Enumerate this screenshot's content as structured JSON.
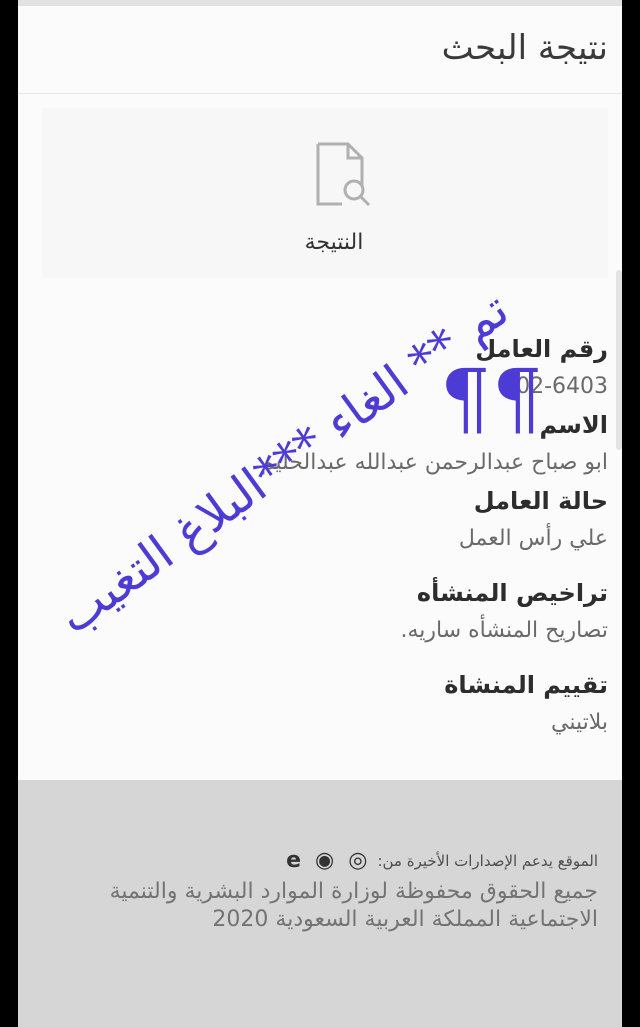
{
  "header": {
    "title": "نتيجة البحث"
  },
  "result": {
    "label": "النتيجة"
  },
  "details": [
    {
      "label": "رقم العامل",
      "value": "102-6403"
    },
    {
      "label": "الاسم",
      "value": "ابو صباح عبدالرحمن عبدالله عبدالحليم"
    },
    {
      "label": "حالة العامل",
      "value": "علي رأس العمل"
    },
    {
      "label": "تراخيص المنشأه",
      "value": "تصاريح المنشأه ساريه."
    },
    {
      "label": "تقييم المنشاة",
      "value": "بلاتيني"
    }
  ],
  "footer": {
    "support_text": "الموقع يدعم الإصدارات الأخيرة من:",
    "browsers": [
      "chrome-icon",
      "firefox-icon",
      "ie-icon"
    ],
    "copyright": "جميع الحقوق محفوظة لوزارة الموارد البشرية والتنمية الاجتماعية المملكة العربية السعودية 2020"
  },
  "stamp": {
    "text": "تم ** الغاء ***البلاغ التغيب"
  },
  "colors": {
    "stamp": "#4d3bd6",
    "footer_bg": "#d6d6d6",
    "page_bg": "#fbfbfb"
  }
}
